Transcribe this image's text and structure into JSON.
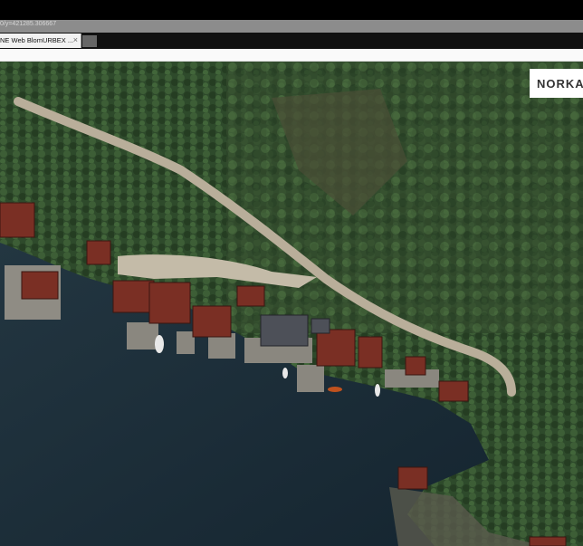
{
  "browser": {
    "url_text": "0/y=421285.306667",
    "tab_title": "NE Web BlomURBEX ...",
    "tab_close_symbol": "×"
  },
  "map": {
    "type": "aerial-imagery",
    "scene": "coastal road with boathouses",
    "logo_text": "NORKA"
  },
  "colors": {
    "forest": "#2f4a2a",
    "water": "#1a2c38",
    "road": "#b9ae9a",
    "roof_red": "#7a2f24"
  }
}
